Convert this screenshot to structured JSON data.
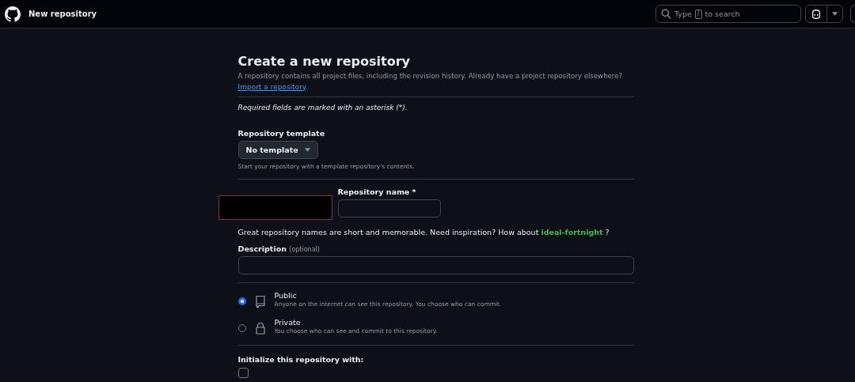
{
  "header": {
    "title": "New repository",
    "search": {
      "before": "Type",
      "key": "/",
      "after": "to search"
    }
  },
  "page": {
    "title": "Create a new repository",
    "intro": "A repository contains all project files, including the revision history. Already have a project repository elsewhere?",
    "import_link": "Import a repository",
    "import_period": ".",
    "required_note": "Required fields are marked with an asterisk (*)."
  },
  "template": {
    "label": "Repository template",
    "value": "No template",
    "hint": "Start your repository with a template repository's contents."
  },
  "owner": {
    "redacted": true
  },
  "repo_name": {
    "label": "Repository name *"
  },
  "suggestion": {
    "text": "Great repository names are short and memorable. Need inspiration? How about",
    "name": "ideal-fortnight",
    "tail": "?"
  },
  "description": {
    "label": "Description",
    "optional": "(optional)"
  },
  "visibility": [
    {
      "kind": "public",
      "label": "Public",
      "hint": "Anyone on the internet can see this repository. You choose who can commit.",
      "selected": true
    },
    {
      "kind": "private",
      "label": "Private",
      "hint": "You choose who can see and commit to this repository.",
      "selected": false
    }
  ],
  "initialize": {
    "label": "Initialize this repository with:",
    "readme_checked": false
  }
}
